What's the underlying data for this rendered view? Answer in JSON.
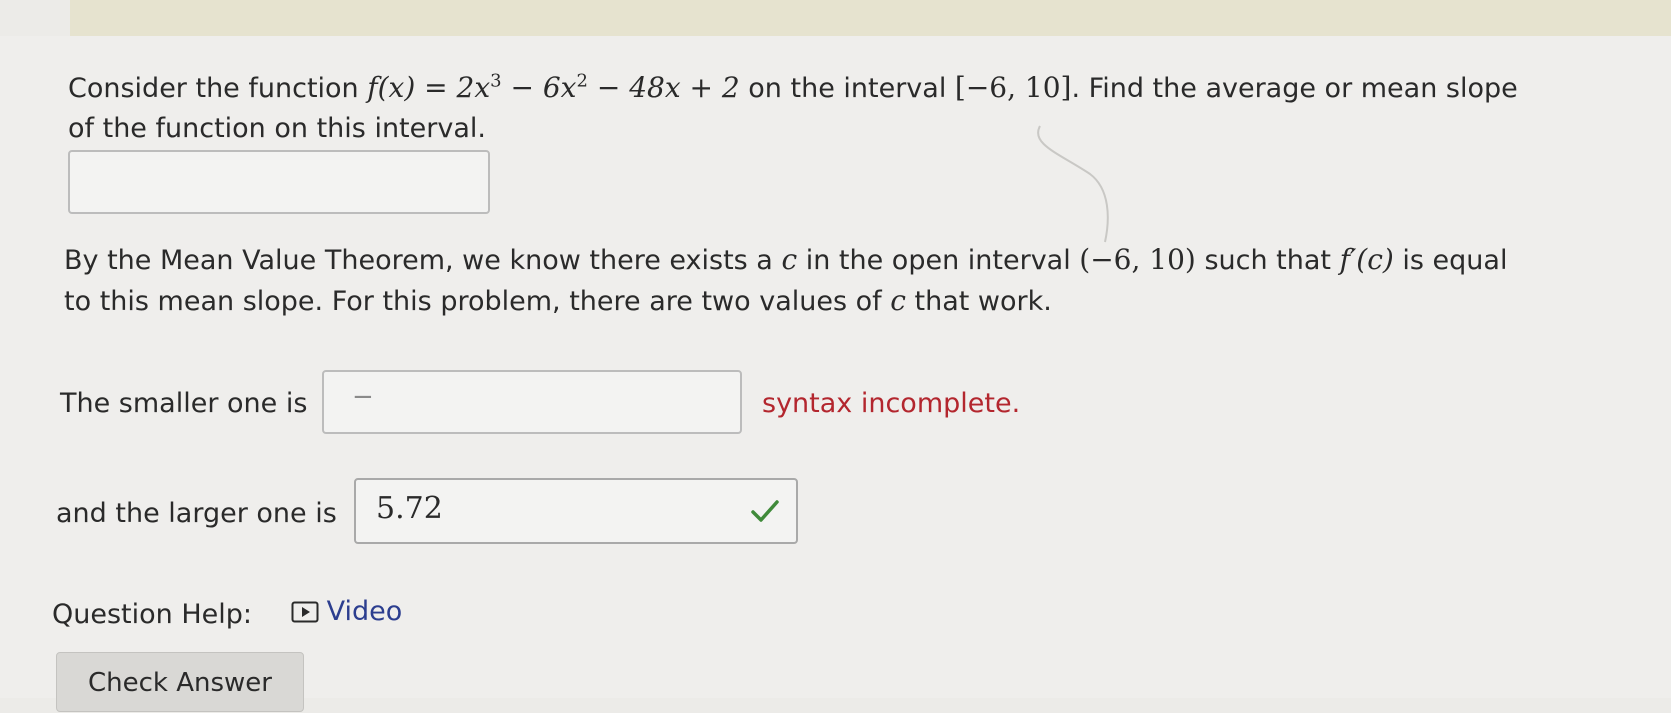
{
  "question": {
    "intro": "Consider the function ",
    "function_lhs": "f(x)",
    "equals": " = ",
    "term1": "2x",
    "exp1": "3",
    "minus1": " − 6x",
    "exp2": "2",
    "rest": " − 48x + 2",
    "on_interval": " on the interval ",
    "interval_closed": "[−6, 10]",
    "task": ". Find the average or mean slope of the function on this interval."
  },
  "mvt": {
    "part1": "By the Mean Value Theorem, we know there exists a ",
    "c1": "c",
    "part2": " in the open interval ",
    "interval_open": "(−6, 10)",
    "part3": " such that ",
    "fprime": "f′(c)",
    "part4": " is equal to this mean slope. For this problem, there are two values of ",
    "c2": "c",
    "part5": " that work."
  },
  "smaller": {
    "label": "The smaller one is",
    "typed": "−",
    "status": "syntax incomplete."
  },
  "larger": {
    "label": "and the larger one is",
    "value": "5.72"
  },
  "help": {
    "label": "Question Help:",
    "video": "Video"
  },
  "buttons": {
    "check": "Check Answer"
  },
  "colors": {
    "error": "#b3262e",
    "correct": "#3f8a3a",
    "link": "#2c3e8f"
  }
}
